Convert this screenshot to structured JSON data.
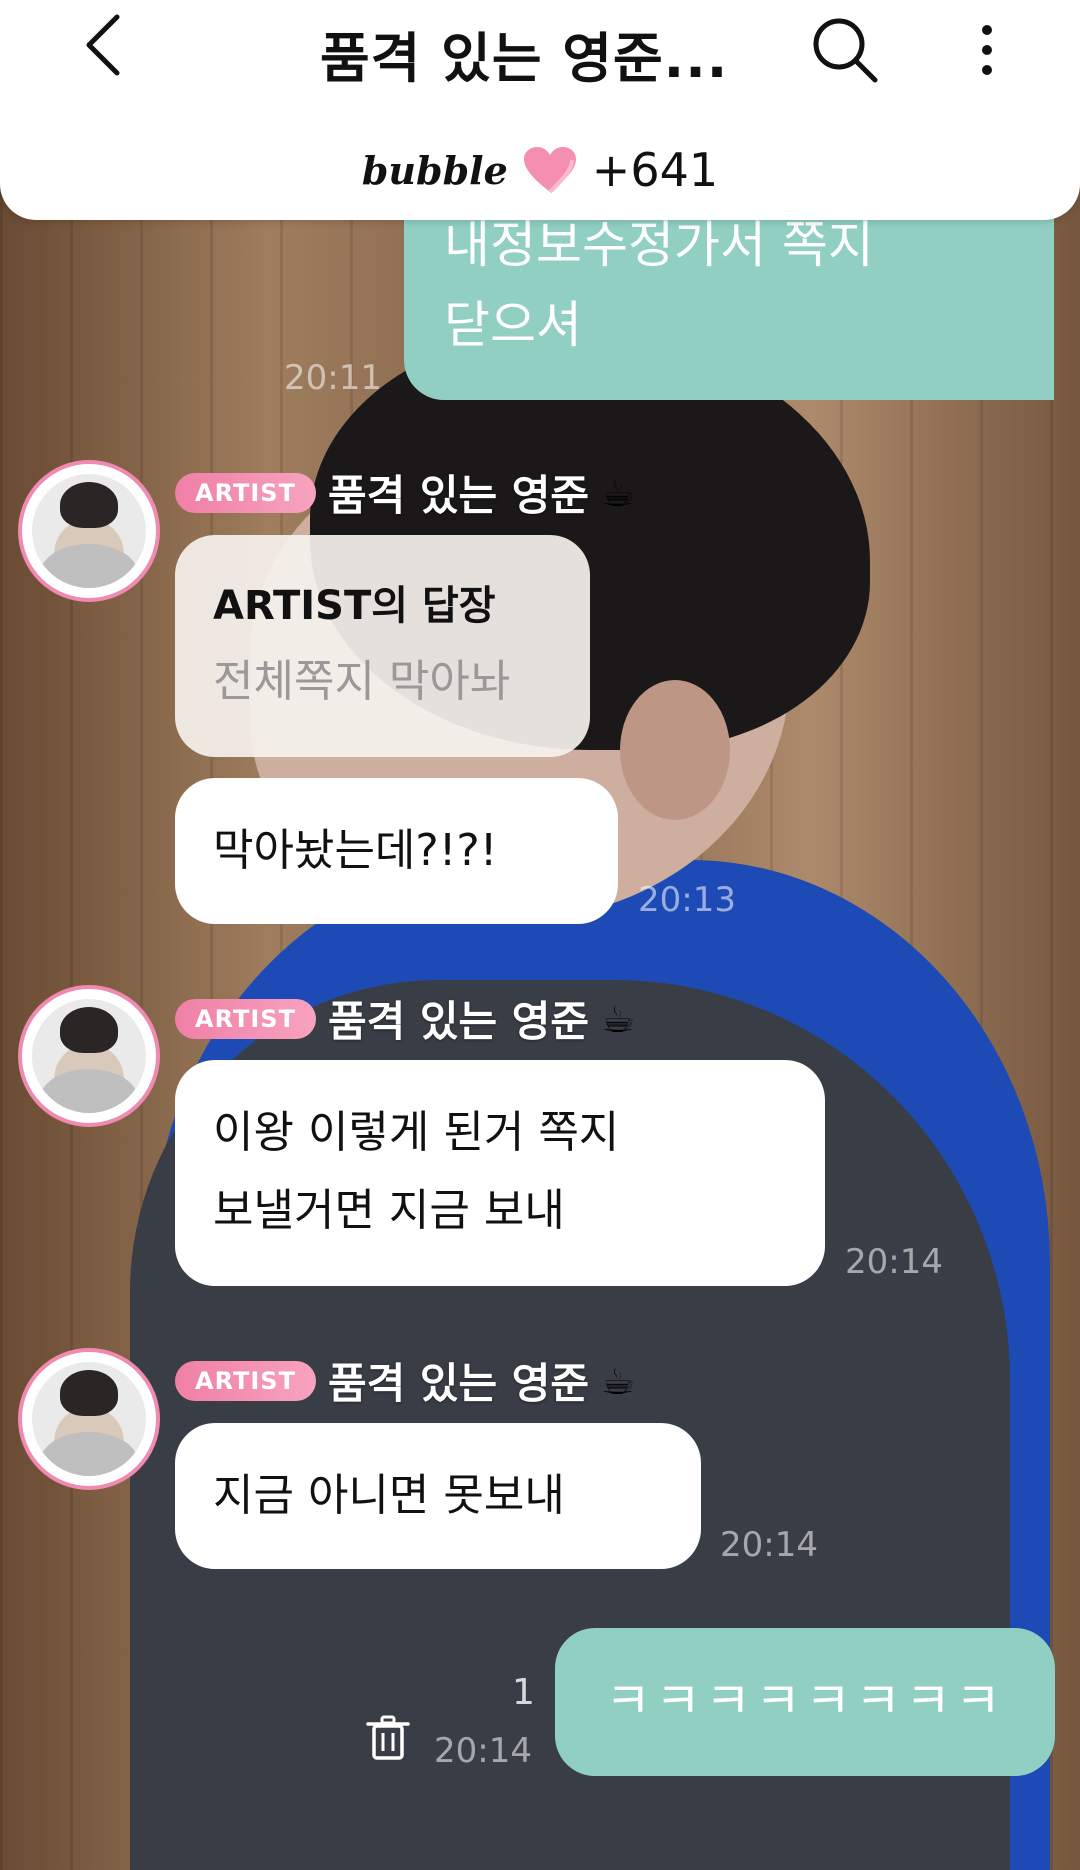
{
  "header": {
    "title": "품격 있는 영준...",
    "brand": "bubble",
    "plus_count": "+641"
  },
  "messages": {
    "mine_top": {
      "text": "내정보수정가서 쪽지\n닫으셔",
      "time": "20:11"
    },
    "group1": {
      "badge": "ARTIST",
      "sender": "품격 있는 영준",
      "cup": "☕",
      "reply_title": "ARTIST의 답장",
      "reply_quote": "전체쪽지 막아놔",
      "text": "막아놨는데?!?!",
      "time": "20:13"
    },
    "group2": {
      "badge": "ARTIST",
      "sender": "품격 있는 영준",
      "cup": "☕",
      "text": "이왕 이렇게 된거 쪽지\n보낼거면 지금 보내",
      "time": "20:14"
    },
    "group3": {
      "badge": "ARTIST",
      "sender": "품격 있는 영준",
      "cup": "☕",
      "text": "지금 아니면 못보내",
      "time": "20:14"
    },
    "mine_bottom": {
      "text": "ㅋㅋㅋㅋㅋㅋㅋㅋ",
      "time": "20:14",
      "unread": "1"
    }
  },
  "colors": {
    "mine_bubble": "#91cfc3",
    "badge": "#f07fa6",
    "avatar_ring": "#f08ab0",
    "heart": "#f58fb1"
  },
  "icons": [
    "back-arrow-icon",
    "search-icon",
    "more-vertical-icon",
    "heart-icon",
    "coffee-cup-icon",
    "trash-icon"
  ]
}
